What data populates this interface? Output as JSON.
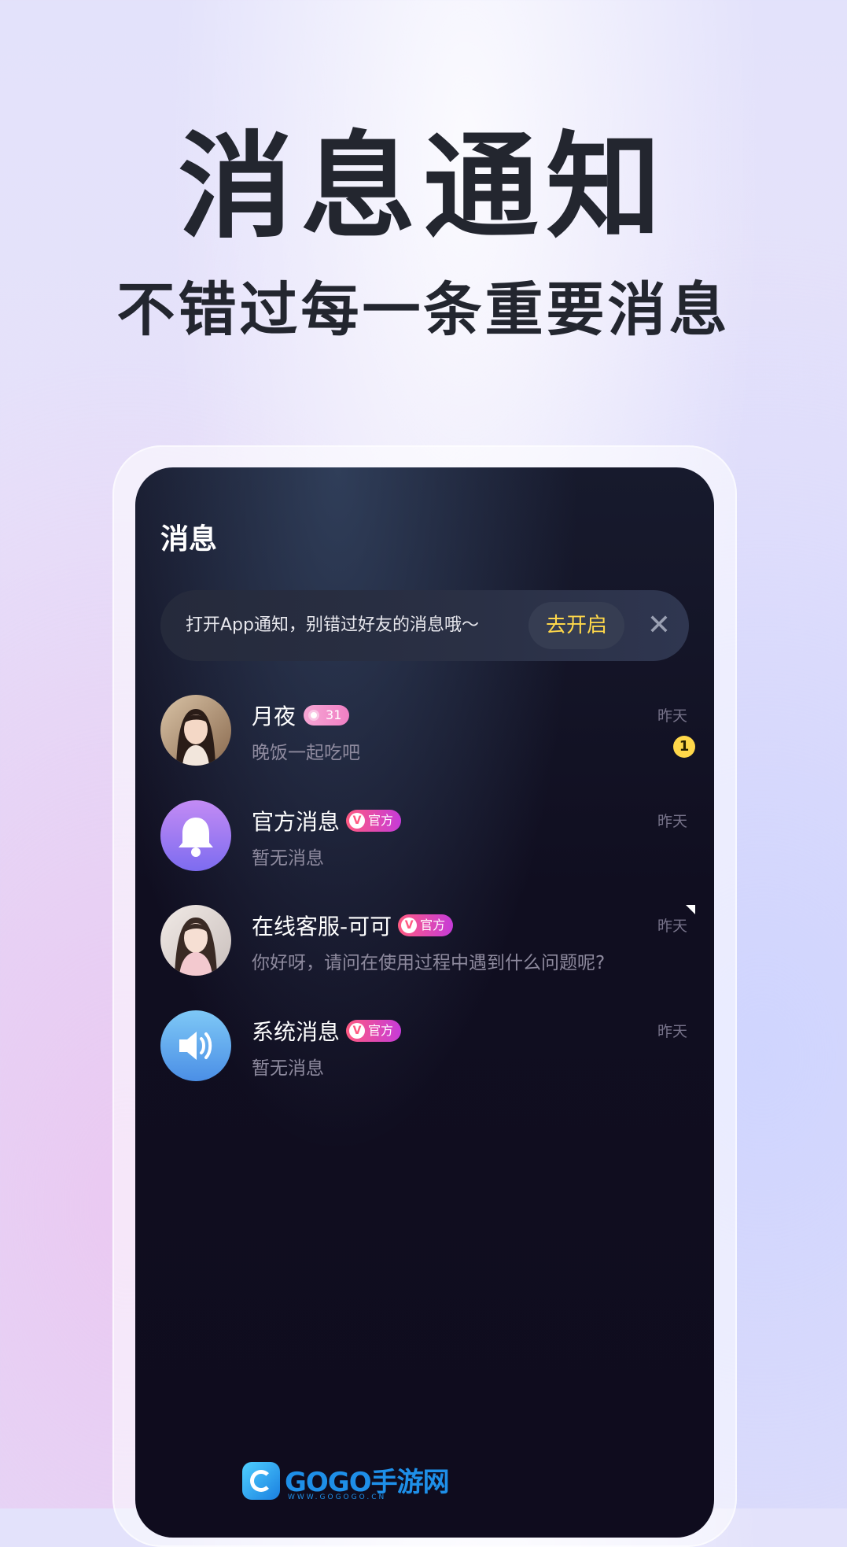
{
  "promo": {
    "headline": "消息通知",
    "subline": "不错过每一条重要消息"
  },
  "screen": {
    "title": "消息",
    "notice": {
      "text": "打开App通知，别错过好友的消息哦～",
      "button_label": "去开启",
      "close_glyph": "✕"
    },
    "conversations": [
      {
        "name": "月夜",
        "level": "31",
        "preview": "晚饭一起吃吧",
        "time": "昨天",
        "unread": "1",
        "avatar": "user-photo"
      },
      {
        "name": "官方消息",
        "badge": "官方",
        "preview": "暂无消息",
        "time": "昨天",
        "avatar": "bell-icon"
      },
      {
        "name": "在线客服-可可",
        "badge": "官方",
        "preview": "你好呀，请问在使用过程中遇到什么问题呢?",
        "time": "昨天",
        "avatar": "user-photo"
      },
      {
        "name": "系统消息",
        "badge": "官方",
        "preview": "暂无消息",
        "time": "昨天",
        "avatar": "speaker-icon"
      }
    ]
  },
  "watermark": {
    "brand": "GOGO手游网",
    "url": "WWW.GOGOGO.CN"
  },
  "colors": {
    "accent_yellow": "#ffd84a",
    "official_badge_start": "#ff5a82",
    "official_badge_end": "#c63bd8",
    "screen_bg": "#100e20",
    "headline": "#23262f"
  }
}
